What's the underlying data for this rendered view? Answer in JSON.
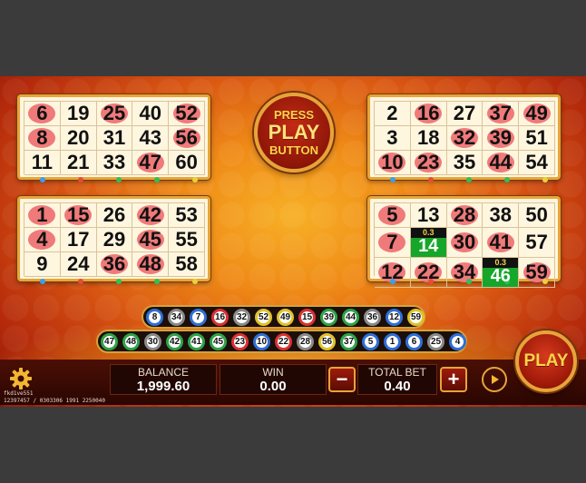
{
  "cards": [
    {
      "id": "card-top-left",
      "rows": [
        [
          6,
          19,
          25,
          40,
          52
        ],
        [
          8,
          20,
          31,
          43,
          56
        ],
        [
          11,
          21,
          33,
          47,
          60
        ]
      ],
      "marked": [
        6,
        25,
        52,
        8,
        56,
        47
      ],
      "wins": [],
      "dot_colors": [
        "#3aa0e8",
        "#e84b3a",
        "#2fbf5c",
        "#2fbf5c",
        "#e8d23a"
      ]
    },
    {
      "id": "card-top-right",
      "rows": [
        [
          2,
          16,
          27,
          37,
          49
        ],
        [
          3,
          18,
          32,
          39,
          51
        ],
        [
          10,
          23,
          35,
          44,
          54
        ]
      ],
      "marked": [
        16,
        37,
        49,
        32,
        39,
        10,
        23,
        44
      ],
      "wins": [],
      "dot_colors": [
        "#3aa0e8",
        "#e84b3a",
        "#2fbf5c",
        "#2fbf5c",
        "#e8d23a"
      ]
    },
    {
      "id": "card-bottom-left",
      "rows": [
        [
          1,
          15,
          26,
          42,
          53
        ],
        [
          4,
          17,
          29,
          45,
          55
        ],
        [
          9,
          24,
          36,
          48,
          58
        ]
      ],
      "marked": [
        1,
        15,
        42,
        4,
        45,
        36,
        48
      ],
      "wins": [],
      "dot_colors": [
        "#3aa0e8",
        "#e84b3a",
        "#2fbf5c",
        "#2fbf5c",
        "#e8d23a"
      ]
    },
    {
      "id": "card-bottom-right",
      "rows": [
        [
          5,
          13,
          28,
          38,
          50
        ],
        [
          7,
          14,
          30,
          41,
          57
        ],
        [
          12,
          22,
          34,
          46,
          59
        ]
      ],
      "marked": [
        5,
        28,
        7,
        30,
        41,
        12,
        22,
        34,
        59
      ],
      "wins": [
        {
          "number": 14,
          "multiplier": "0.3"
        },
        {
          "number": 46,
          "multiplier": "0.3"
        }
      ],
      "dot_colors": [
        "#3aa0e8",
        "#e84b3a",
        "#2fbf5c",
        "#2fbf5c",
        "#e8d23a"
      ]
    }
  ],
  "press_button": {
    "line1": "PRESS",
    "line2": "PLAY",
    "line3": "BUTTON"
  },
  "drawn_balls_row1": [
    8,
    34,
    7,
    16,
    32,
    52,
    49,
    15,
    39,
    44,
    36,
    12,
    59
  ],
  "drawn_balls_row2": [
    47,
    48,
    30,
    42,
    41,
    45,
    23,
    10,
    22,
    28,
    56,
    37,
    5,
    1,
    6,
    25,
    4
  ],
  "footer": {
    "balance_label": "BALANCE",
    "balance_value": "1,999.60",
    "win_label": "WIN",
    "win_value": "0.00",
    "total_bet_label": "TOTAL BET",
    "total_bet_value": "0.40",
    "minus": "−",
    "plus": "+",
    "play": "PLAY",
    "session_line1": "fkd1ve551",
    "session_line2": "12397457 / 0303306 1991 2250040"
  },
  "colors": {
    "accent_gold": "#e6a43a",
    "mark_red": "#f07a7a",
    "win_green": "#16a62a"
  }
}
